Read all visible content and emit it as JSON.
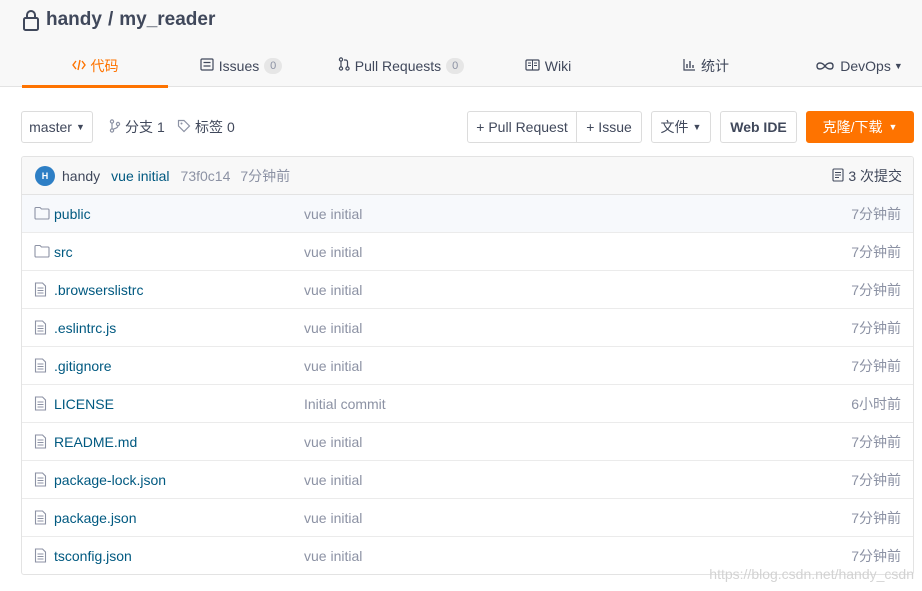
{
  "repo": {
    "owner": "handy",
    "separator": "/",
    "name": "my_reader"
  },
  "tabs": [
    {
      "label": "代码",
      "icon": "code-icon"
    },
    {
      "label": "Issues",
      "icon": "issues-icon",
      "count": "0"
    },
    {
      "label": "Pull Requests",
      "icon": "pull-request-icon",
      "count": "0"
    },
    {
      "label": "Wiki",
      "icon": "wiki-icon"
    },
    {
      "label": "统计",
      "icon": "chart-icon"
    },
    {
      "label": "DevOps",
      "icon": "devops-icon"
    }
  ],
  "toolbar": {
    "branch": "master",
    "branch_label": "分支",
    "branch_count": "1",
    "tag_label": "标签",
    "tag_count": "0",
    "pull_request": "+ Pull Request",
    "issue": "+ Issue",
    "file": "文件",
    "web_ide": "Web IDE",
    "clone": "克隆/下载"
  },
  "commit": {
    "avatar_letter": "H",
    "author": "handy",
    "message": "vue initial",
    "sha": "73f0c14",
    "time": "7分钟前",
    "count_text": "3 次提交"
  },
  "files": [
    {
      "name": "public",
      "type": "folder",
      "message": "vue initial",
      "time": "7分钟前"
    },
    {
      "name": "src",
      "type": "folder",
      "message": "vue initial",
      "time": "7分钟前"
    },
    {
      "name": ".browserslistrc",
      "type": "file",
      "message": "vue initial",
      "time": "7分钟前"
    },
    {
      "name": ".eslintrc.js",
      "type": "file",
      "message": "vue initial",
      "time": "7分钟前"
    },
    {
      "name": ".gitignore",
      "type": "file",
      "message": "vue initial",
      "time": "7分钟前"
    },
    {
      "name": "LICENSE",
      "type": "file",
      "message": "Initial commit",
      "time": "6小时前"
    },
    {
      "name": "README.md",
      "type": "file",
      "message": "vue initial",
      "time": "7分钟前"
    },
    {
      "name": "package-lock.json",
      "type": "file",
      "message": "vue initial",
      "time": "7分钟前"
    },
    {
      "name": "package.json",
      "type": "file",
      "message": "vue initial",
      "time": "7分钟前"
    },
    {
      "name": "tsconfig.json",
      "type": "file",
      "message": "vue initial",
      "time": "7分钟前"
    }
  ],
  "watermark": "https://blog.csdn.net/handy_csdn",
  "colors": {
    "accent": "#fe7300",
    "link": "#005980",
    "muted": "#8c92a4",
    "text": "#40485b"
  }
}
